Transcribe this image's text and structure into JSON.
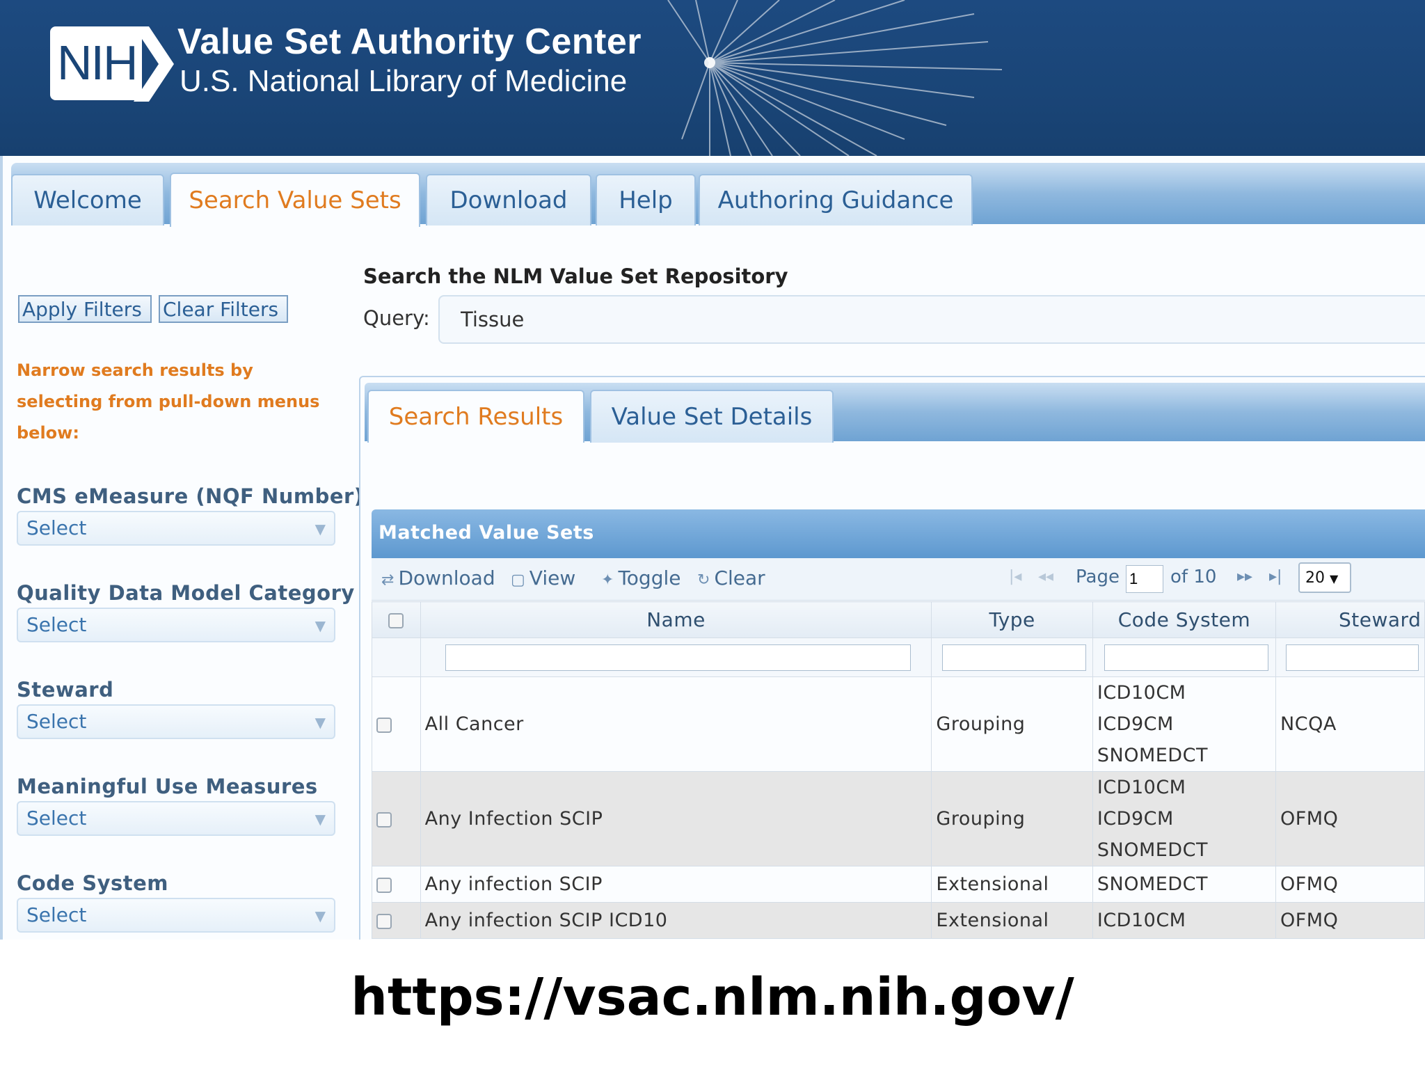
{
  "header": {
    "logo_text": "NIH",
    "title": "Value Set Authority Center",
    "subtitle": "U.S. National Library of Medicine"
  },
  "main_tabs": [
    {
      "label": "Welcome",
      "active": false
    },
    {
      "label": "Search Value Sets",
      "active": true
    },
    {
      "label": "Download",
      "active": false
    },
    {
      "label": "Help",
      "active": false
    },
    {
      "label": "Authoring Guidance",
      "active": false
    }
  ],
  "sidebar": {
    "apply_label": "Apply Filters",
    "clear_label": "Clear Filters",
    "narrow_text": "Narrow search results by selecting from pull-down menus below:",
    "filters": [
      {
        "label": "CMS eMeasure (NQF Number)",
        "value": "Select"
      },
      {
        "label": "Quality Data Model Category",
        "value": "Select"
      },
      {
        "label": "Steward",
        "value": "Select"
      },
      {
        "label": "Meaningful Use Measures",
        "value": "Select"
      },
      {
        "label": "Code System",
        "value": "Select"
      }
    ]
  },
  "search": {
    "heading": "Search the NLM Value Set Repository",
    "query_label": "Query:",
    "query_value": "Tissue"
  },
  "result_tabs": [
    {
      "label": "Search Results",
      "active": true
    },
    {
      "label": "Value Set Details",
      "active": false
    }
  ],
  "grid": {
    "title": "Matched Value Sets",
    "toolbar": {
      "download": "Download",
      "view": "View",
      "toggle": "Toggle",
      "clear": "Clear",
      "page_label": "Page",
      "page_value": "1",
      "of_label": "of 10",
      "rows_per_page": "20"
    },
    "columns": [
      "Name",
      "Type",
      "Code System",
      "Steward"
    ],
    "rows": [
      {
        "name": "All Cancer",
        "type": "Grouping",
        "code_systems": [
          "ICD10CM",
          "ICD9CM",
          "SNOMEDCT"
        ],
        "steward": "NCQA"
      },
      {
        "name": "Any Infection SCIP",
        "type": "Grouping",
        "code_systems": [
          "ICD10CM",
          "ICD9CM",
          "SNOMEDCT"
        ],
        "steward": "OFMQ"
      },
      {
        "name": "Any infection SCIP",
        "type": "Extensional",
        "code_systems": [
          "SNOMEDCT"
        ],
        "steward": "OFMQ"
      },
      {
        "name": "Any infection SCIP ICD10",
        "type": "Extensional",
        "code_systems": [
          "ICD10CM"
        ],
        "steward": "OFMQ"
      }
    ]
  },
  "caption": "https://vsac.nlm.nih.gov/",
  "colors": {
    "banner": "#1a4577",
    "active_tab_text": "#e07b1f",
    "tab_text": "#2b5f95",
    "grid_header": "#5d98cf"
  },
  "icons": [
    "nih-chevron-icon",
    "download-icon",
    "view-icon",
    "toggle-pin-icon",
    "clear-icon",
    "first-page-icon",
    "prev-page-icon",
    "next-page-icon",
    "last-page-icon",
    "dropdown-arrow-icon"
  ]
}
